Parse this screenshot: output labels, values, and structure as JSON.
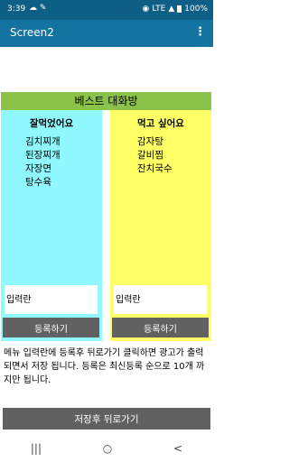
{
  "status": {
    "time": "3:39",
    "signal_text": "LTE",
    "battery_percent": "100%"
  },
  "app_bar": {
    "title": "Screen2",
    "menu_icon": "more-vertical-icon",
    "menu_glyph": "⋮"
  },
  "banner": "베스트   대화방",
  "left_column": {
    "heading": "잘먹었어요",
    "items": [
      "김치찌개",
      "된장찌개",
      "자장면",
      "탕수육"
    ],
    "input_placeholder": "입력란",
    "button_label": "등록하기",
    "background": "#8ff9ff"
  },
  "right_column": {
    "heading": "먹고 싶어요",
    "items": [
      "감자탕",
      "갈비찜",
      "잔치국수"
    ],
    "input_placeholder": "입력란",
    "button_label": "등록하기",
    "background": "#ffff66"
  },
  "info_text": "  메뉴 입력란에  등록후 뒤로가기 클릭하면 광고가 출력되면서 저장 됩니다.      등록은 최신등록 순으로 10개 까지만 됩니다.",
  "save_button": "저장후 뒤로가기",
  "nav": {
    "recents": "|||",
    "home": "○",
    "back": "<"
  },
  "colors": {
    "app_bar": "#1373a1",
    "status_bar": "#0d5f85",
    "banner": "#8bc34a",
    "button": "#616161"
  }
}
